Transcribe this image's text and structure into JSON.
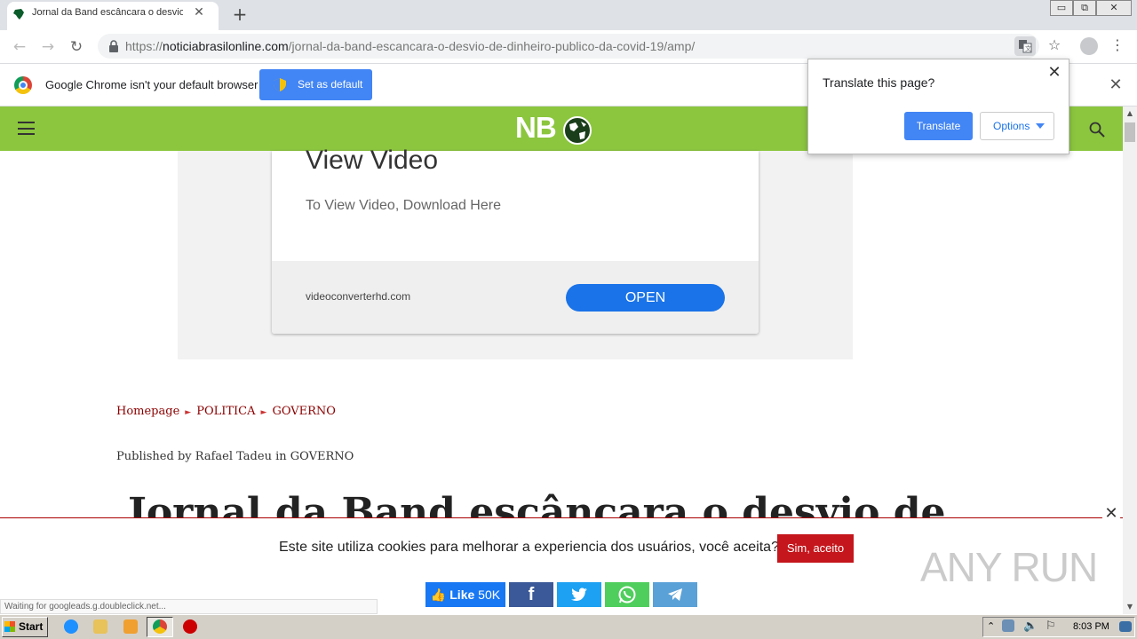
{
  "browser": {
    "tab_title": "Jornal da Band escâncara o desvio de",
    "tab_close": "✕",
    "new_tab": "+",
    "url_scheme": "https://",
    "url_host": "noticiabrasilonline.com",
    "url_path": "/jornal-da-band-escancara-o-desvio-de-dinheiro-publico-da-covid-19/amp/",
    "window_minimize": "▭",
    "window_restore": "⧉",
    "window_close": "✕"
  },
  "infobar": {
    "message": "Google Chrome isn't your default browser",
    "set_default_label": "Set as default",
    "close": "✕"
  },
  "translate_popup": {
    "title": "Translate this page?",
    "translate_label": "Translate",
    "options_label": "Options",
    "close": "✕"
  },
  "site": {
    "logo_text": "NB"
  },
  "ad": {
    "title": "View Video",
    "subtitle": "To View Video, Download Here",
    "domain": "videoconverterhd.com",
    "open_label": "OPEN"
  },
  "article": {
    "breadcrumb": [
      "Homepage",
      "POLITICA",
      "GOVERNO"
    ],
    "breadcrumb_sep": "►",
    "byline_prefix": "Published by",
    "author": "Rafael Tadeu",
    "byline_in": "in",
    "category": "GOVERNO",
    "title": "Jornal da Band escâncara o desvio de"
  },
  "cookie": {
    "message": "Este site utiliza cookies para melhorar a experiencia dos usuários, você aceita?",
    "accept_label": "Sim, aceito",
    "close": "✕"
  },
  "share": {
    "like_label": "Like",
    "like_count": "50K",
    "facebook": "f"
  },
  "status_text": "Waiting for googleads.g.doubleclick.net...",
  "watermark": "ANY RUN",
  "taskbar": {
    "start_label": "Start",
    "clock": "8:03 PM"
  },
  "colors": {
    "site_header": "#8cc63f",
    "chrome_blue": "#4285f4",
    "cookie_accept": "#c4161c",
    "breadcrumb": "#8b0000"
  }
}
